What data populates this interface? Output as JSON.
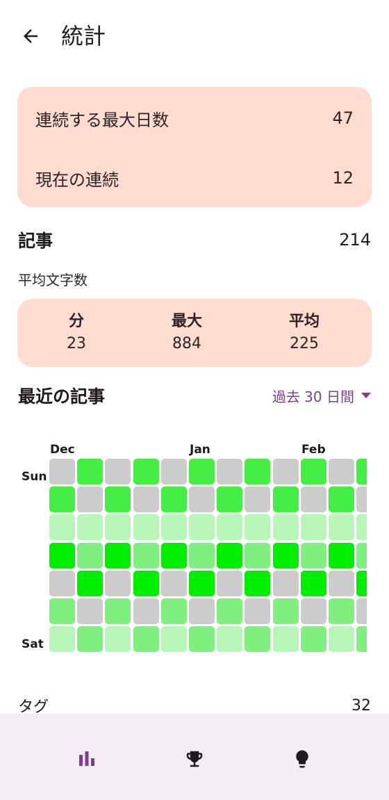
{
  "header": {
    "title": "統計",
    "back_icon": "arrow-back-icon"
  },
  "streaks": {
    "longest_label": "連続する最大日数",
    "longest_value": "47",
    "current_label": "現在の連続",
    "current_value": "12"
  },
  "entries": {
    "label": "記事",
    "count": "214"
  },
  "word_count": {
    "title": "平均文字数",
    "min_label": "分",
    "min_value": "23",
    "max_label": "最大",
    "max_value": "884",
    "avg_label": "平均",
    "avg_value": "225"
  },
  "recent": {
    "label": "最近の記事",
    "range_label": "過去 30 日間",
    "range_icon": "triangle-down-icon"
  },
  "heatmap": {
    "months": [
      "Dec",
      "Jan",
      "Feb"
    ],
    "days": [
      "Sun",
      "Sat"
    ],
    "colors": [
      "#cccccc",
      "#b8f5b8",
      "#7ff07f",
      "#44ee44",
      "#00ee00"
    ],
    "rows": [
      [
        0,
        3,
        0,
        3,
        0,
        3,
        0,
        3,
        0,
        3,
        0,
        3
      ],
      [
        3,
        0,
        3,
        0,
        3,
        0,
        3,
        0,
        3,
        0,
        3,
        0
      ],
      [
        1,
        1,
        1,
        1,
        1,
        1,
        1,
        1,
        1,
        1,
        1,
        1
      ],
      [
        4,
        2,
        4,
        2,
        4,
        2,
        4,
        2,
        4,
        2,
        4,
        2
      ],
      [
        0,
        4,
        0,
        4,
        0,
        4,
        0,
        4,
        0,
        4,
        0,
        4
      ],
      [
        2,
        0,
        2,
        0,
        2,
        0,
        2,
        0,
        2,
        0,
        2,
        0
      ],
      [
        1,
        2,
        1,
        2,
        1,
        2,
        1,
        2,
        1,
        2,
        1,
        2
      ]
    ]
  },
  "tags": {
    "label": "タグ",
    "count": "32"
  },
  "nav": {
    "items": [
      {
        "icon": "bar-chart-icon",
        "active": true
      },
      {
        "icon": "trophy-icon",
        "active": false
      },
      {
        "icon": "lightbulb-icon",
        "active": false
      }
    ],
    "active_color": "#7b3f8e",
    "inactive_color": "#1f1a1c"
  }
}
